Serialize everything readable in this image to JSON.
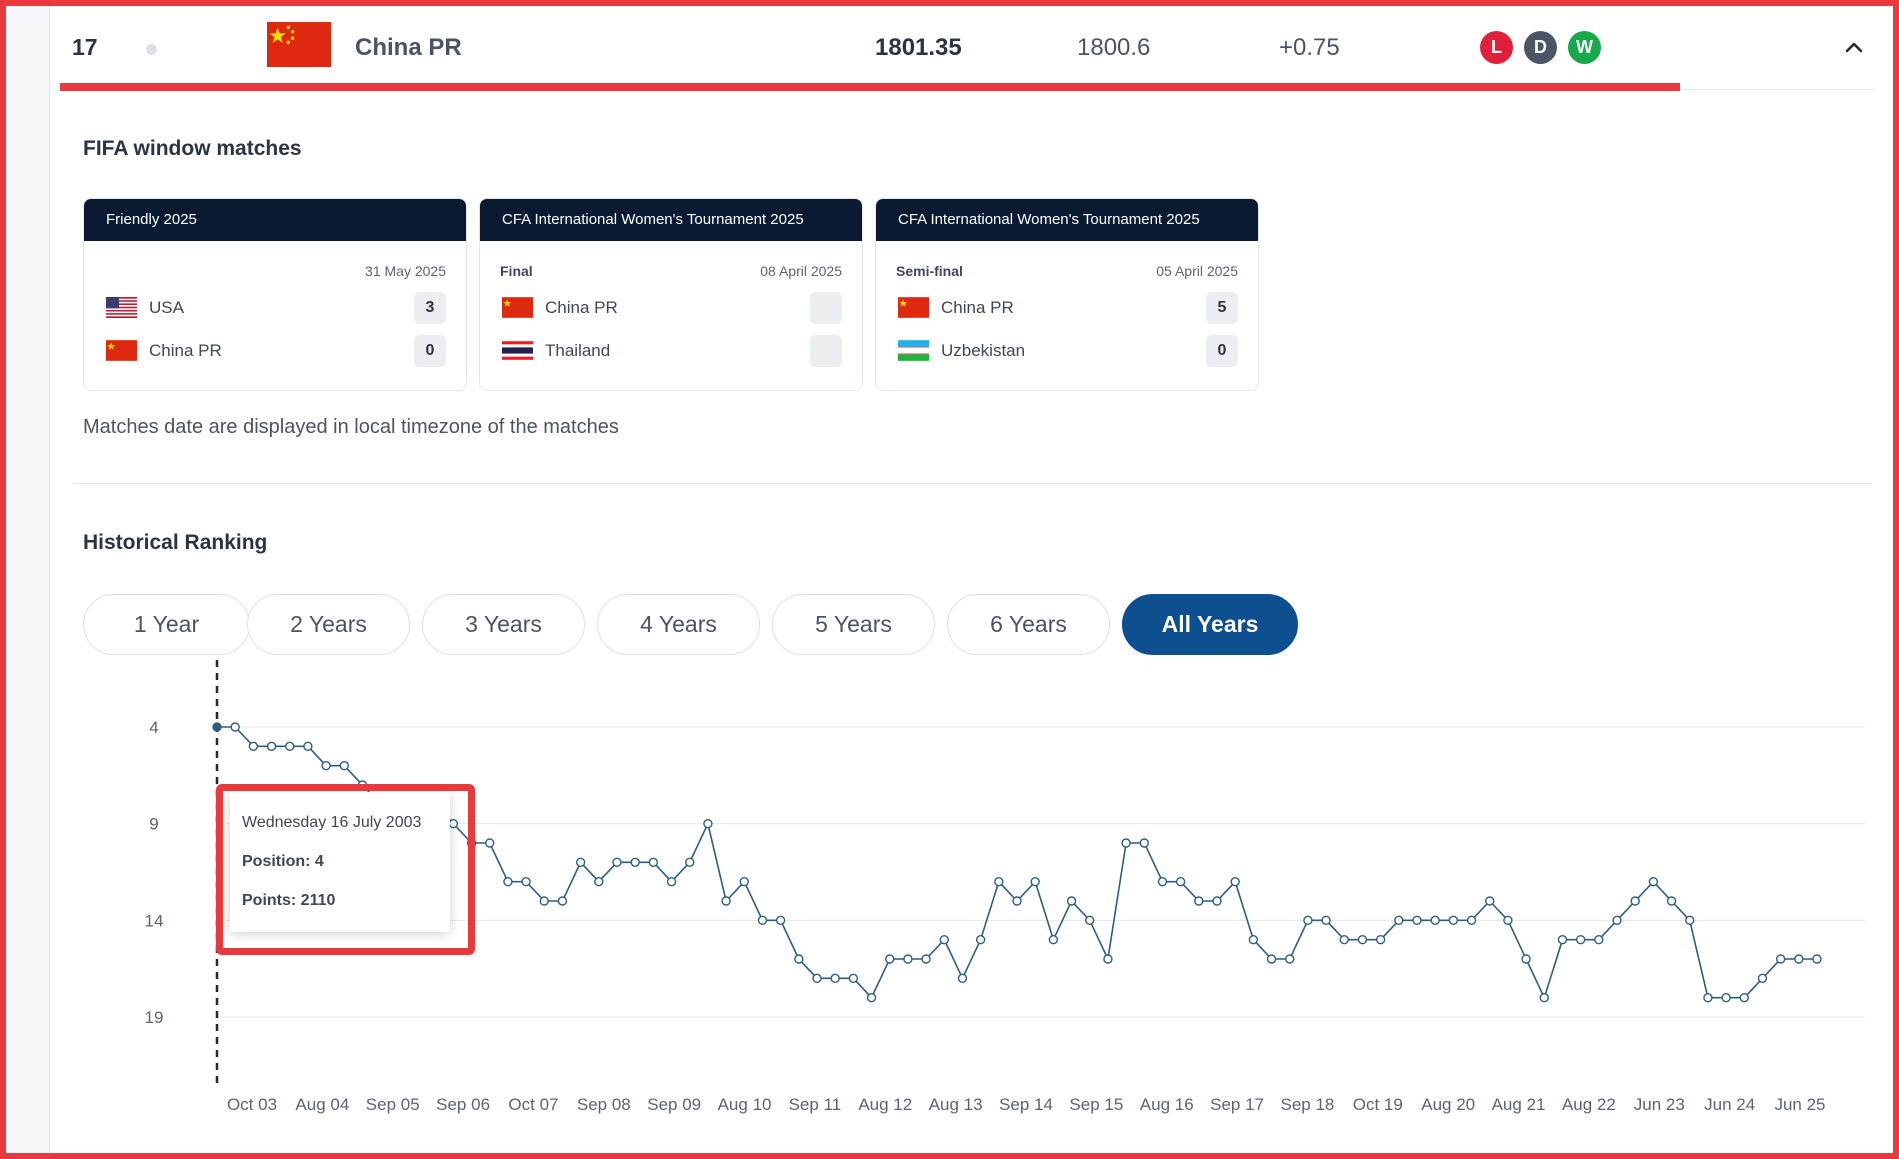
{
  "row": {
    "rank": "17",
    "team": "China PR",
    "total_points": "1801.35",
    "previous_points": "1800.6",
    "change": "+0.75",
    "form": [
      {
        "label": "L",
        "color": "#e0203a"
      },
      {
        "label": "D",
        "color": "#4a5566"
      },
      {
        "label": "W",
        "color": "#18a94d"
      }
    ],
    "collapse_icon": "chevron-up-icon"
  },
  "fifa_window": {
    "title": "FIFA window matches",
    "cards": [
      {
        "competition": "Friendly 2025",
        "stage": "",
        "date": "31 May 2025",
        "teams": [
          {
            "name": "USA",
            "score": "3",
            "flag": "usa-flag-icon"
          },
          {
            "name": "China PR",
            "score": "0",
            "flag": "china-flag-icon"
          }
        ]
      },
      {
        "competition": "CFA International Women's Tournament 2025",
        "stage": "Final",
        "date": "08 April 2025",
        "teams": [
          {
            "name": "China PR",
            "score": "",
            "flag": "china-flag-icon"
          },
          {
            "name": "Thailand",
            "score": "",
            "flag": "thailand-flag-icon"
          }
        ]
      },
      {
        "competition": "CFA International Women's Tournament 2025",
        "stage": "Semi-final",
        "date": "05 April 2025",
        "teams": [
          {
            "name": "China PR",
            "score": "5",
            "flag": "china-flag-icon"
          },
          {
            "name": "Uzbekistan",
            "score": "0",
            "flag": "uzbekistan-flag-icon"
          }
        ]
      }
    ],
    "note": "Matches date are displayed in local timezone of the matches"
  },
  "historical": {
    "title": "Historical Ranking",
    "ranges": [
      "1 Year",
      "2 Years",
      "3 Years",
      "4 Years",
      "5 Years",
      "6 Years",
      "All Years"
    ],
    "active_range": "All Years",
    "tooltip": {
      "date": "Wednesday 16 July 2003",
      "position": "Position: 4",
      "points": "Points: 2110"
    }
  },
  "colors": {
    "accent_red": "#e8393f",
    "navy": "#0b1a33",
    "active_pill": "#0d4f8f",
    "line": "#2e5d7e"
  },
  "chart_data": {
    "type": "line",
    "y_reversed": true,
    "ylim": [
      4,
      19
    ],
    "yticks": [
      "4",
      "9",
      "14",
      "19"
    ],
    "grid": true,
    "x_ticks": [
      "Oct 03",
      "Aug 04",
      "Sep 05",
      "Sep 06",
      "Oct 07",
      "Sep 08",
      "Sep 09",
      "Aug 10",
      "Sep 11",
      "Aug 12",
      "Aug 13",
      "Sep 14",
      "Sep 15",
      "Aug 16",
      "Sep 17",
      "Sep 18",
      "Oct 19",
      "Aug 20",
      "Aug 21",
      "Aug 22",
      "Jun 23",
      "Jun 24",
      "Jun 25"
    ],
    "series": [
      {
        "values": [
          4,
          4,
          5,
          5,
          5,
          5,
          6,
          6,
          7,
          8,
          8,
          8,
          8,
          9,
          10,
          10,
          12,
          12,
          13,
          13,
          11,
          12,
          11,
          11,
          11,
          12,
          11,
          9,
          13,
          12,
          14,
          14,
          16,
          17,
          17,
          17,
          18,
          16,
          16,
          16,
          15,
          17,
          15,
          12,
          13,
          12,
          15,
          13,
          14,
          16,
          10,
          10,
          12,
          12,
          13,
          13,
          12,
          15,
          16,
          16,
          14,
          14,
          15,
          15,
          15,
          14,
          14,
          14,
          14,
          14,
          13,
          14,
          16,
          18,
          15,
          15,
          15,
          14,
          13,
          12,
          13,
          14,
          18,
          18,
          18,
          17,
          16,
          16,
          16
        ]
      }
    ]
  }
}
